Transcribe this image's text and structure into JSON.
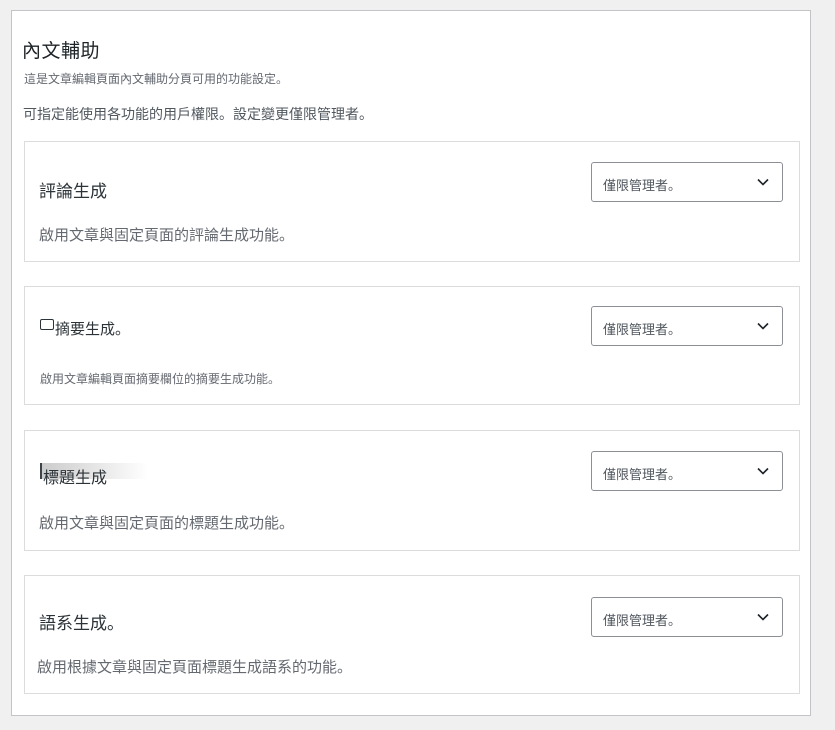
{
  "section": {
    "title": "內文輔助",
    "subtitle": "這是文章編輯頁面內文輔助分頁可用的功能設定。",
    "note": "可指定能使用各功能的用戶權限。設定變更僅限管理者。"
  },
  "cards": [
    {
      "title": "評論生成",
      "description": "啟用文章與固定頁面的評論生成功能。",
      "select_value": "僅限管理者。"
    },
    {
      "title": "摘要生成。",
      "description": "啟用文章編輯頁面摘要欄位的摘要生成功能。",
      "select_value": "僅限管理者。"
    },
    {
      "title": "標題生成",
      "description": "啟用文章與固定頁面的標題生成功能。",
      "select_value": "僅限管理者。"
    },
    {
      "title": "語系生成。",
      "description": "啟用根據文章與固定頁面標題生成語系的功能。",
      "select_value": "僅限管理者。"
    }
  ],
  "icons": {
    "select_arrow": "chevron-down-icon",
    "card2_marker": "checkbox-icon"
  }
}
